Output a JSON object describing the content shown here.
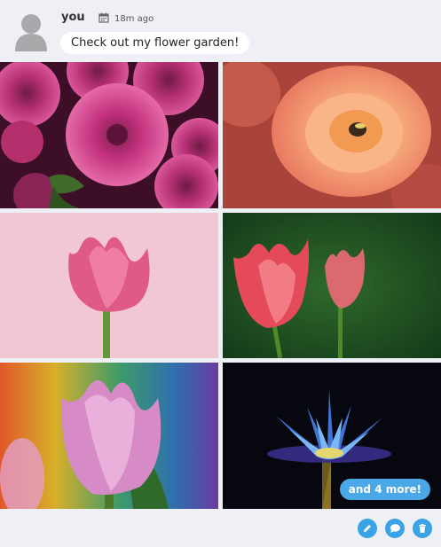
{
  "post": {
    "username": "you",
    "time": "18m ago",
    "message": "Check out my flower garden!",
    "more_label": "and 4 more!"
  },
  "colors": {
    "accent": "#3aa2e6",
    "bg": "#eef0f5"
  },
  "images": [
    {
      "name": "dahlias-photo",
      "desc": "pink dahlias"
    },
    {
      "name": "peach-rose-photo",
      "desc": "peach rose with bee"
    },
    {
      "name": "pink-tulip-photo",
      "desc": "pink tulip on pink background"
    },
    {
      "name": "red-tulips-photo",
      "desc": "red tulips on green"
    },
    {
      "name": "dewy-tulip-photo",
      "desc": "pink tulip with dew"
    },
    {
      "name": "blue-waterlily-photo",
      "desc": "blue water lily on black"
    }
  ],
  "actions": [
    "pencil-icon",
    "comment-icon",
    "trash-icon"
  ]
}
